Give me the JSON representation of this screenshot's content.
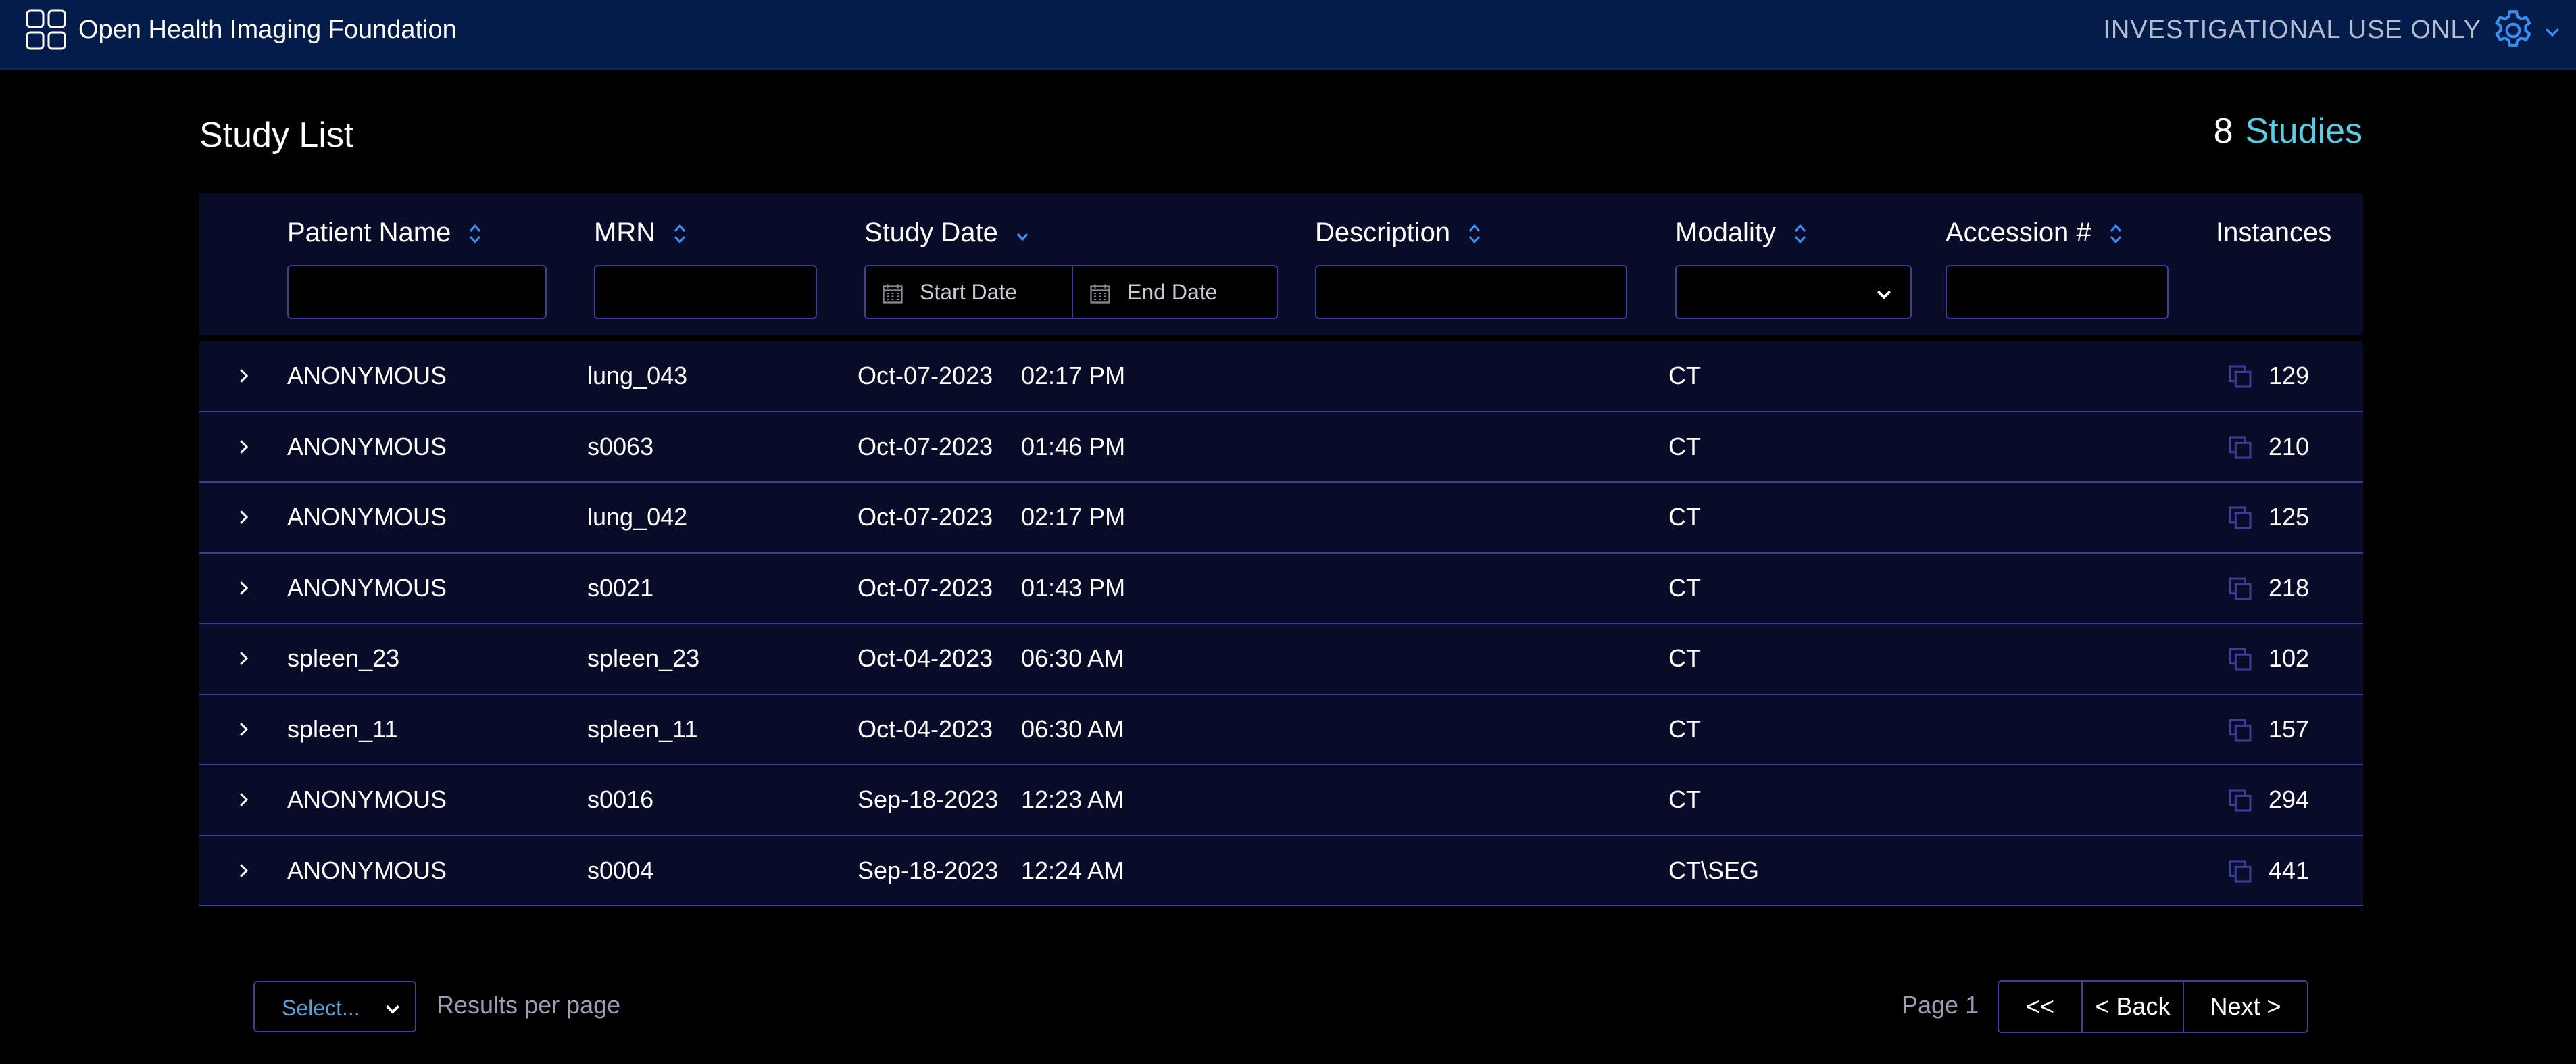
{
  "header": {
    "app_title": "Open Health Imaging Foundation",
    "notice": "INVESTIGATIONAL USE ONLY",
    "logo_icon": "grid-icon",
    "settings_icon": "gear-icon"
  },
  "page": {
    "title": "Study List",
    "study_count": "8",
    "study_count_label": "Studies"
  },
  "columns": {
    "patient_name": "Patient Name",
    "mrn": "MRN",
    "study_date": "Study Date",
    "description": "Description",
    "modality": "Modality",
    "accession": "Accession #",
    "instances": "Instances"
  },
  "filters": {
    "start_date_placeholder": "Start Date",
    "end_date_placeholder": "End Date",
    "patient_name": "",
    "mrn": "",
    "description": "",
    "modality": "",
    "accession": ""
  },
  "rows": [
    {
      "patient": "ANONYMOUS",
      "mrn": "lung_043",
      "date": "Oct-07-2023",
      "time": "02:17 PM",
      "description": "",
      "modality": "CT",
      "accession": "",
      "instances": "129"
    },
    {
      "patient": "ANONYMOUS",
      "mrn": "s0063",
      "date": "Oct-07-2023",
      "time": "01:46 PM",
      "description": "",
      "modality": "CT",
      "accession": "",
      "instances": "210"
    },
    {
      "patient": "ANONYMOUS",
      "mrn": "lung_042",
      "date": "Oct-07-2023",
      "time": "02:17 PM",
      "description": "",
      "modality": "CT",
      "accession": "",
      "instances": "125"
    },
    {
      "patient": "ANONYMOUS",
      "mrn": "s0021",
      "date": "Oct-07-2023",
      "time": "01:43 PM",
      "description": "",
      "modality": "CT",
      "accession": "",
      "instances": "218"
    },
    {
      "patient": "spleen_23",
      "mrn": "spleen_23",
      "date": "Oct-04-2023",
      "time": "06:30 AM",
      "description": "",
      "modality": "CT",
      "accession": "",
      "instances": "102"
    },
    {
      "patient": "spleen_11",
      "mrn": "spleen_11",
      "date": "Oct-04-2023",
      "time": "06:30 AM",
      "description": "",
      "modality": "CT",
      "accession": "",
      "instances": "157"
    },
    {
      "patient": "ANONYMOUS",
      "mrn": "s0016",
      "date": "Sep-18-2023",
      "time": "12:23 AM",
      "description": "",
      "modality": "CT",
      "accession": "",
      "instances": "294"
    },
    {
      "patient": "ANONYMOUS",
      "mrn": "s0004",
      "date": "Sep-18-2023",
      "time": "12:24 AM",
      "description": "",
      "modality": "CT\\SEG",
      "accession": "",
      "instances": "441"
    }
  ],
  "footer": {
    "results_select": "Select...",
    "results_per_page": "Results per page",
    "page_label": "Page 1",
    "first": "<<",
    "back": "< Back",
    "next": "Next >"
  },
  "colors": {
    "header_bg": "#041c4a",
    "table_bg": "#090c29",
    "border": "#3a3f99",
    "accent": "#5acce6"
  }
}
